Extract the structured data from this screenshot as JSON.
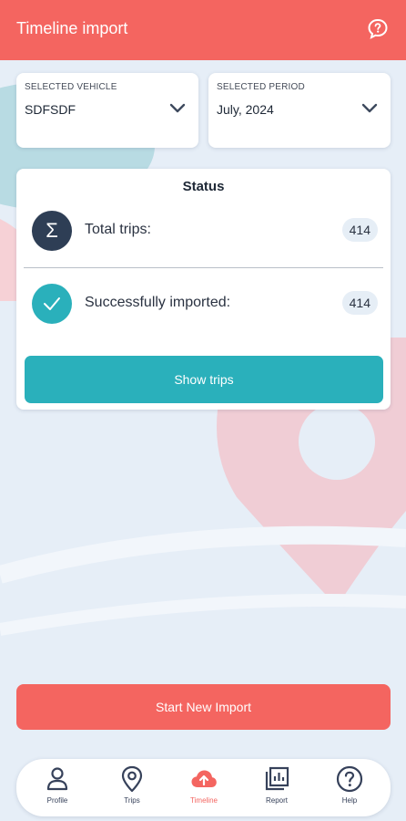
{
  "header": {
    "title": "Timeline import"
  },
  "selectors": {
    "vehicle": {
      "caption": "SELECTED VEHICLE",
      "value": "SDFSDF"
    },
    "period": {
      "caption": "SELECTED PERIOD",
      "value": "July, 2024"
    }
  },
  "status": {
    "title": "Status",
    "total": {
      "label": "Total trips:",
      "count": "414",
      "icon": "sigma-icon"
    },
    "imported": {
      "label": "Successfully imported:",
      "count": "414",
      "icon": "check-icon"
    },
    "show_trips_label": "Show trips"
  },
  "actions": {
    "start_import_label": "Start New Import"
  },
  "nav": {
    "items": [
      {
        "label": "Profile",
        "icon": "person-icon"
      },
      {
        "label": "Trips",
        "icon": "location-pin-icon"
      },
      {
        "label": "Timeline",
        "icon": "cloud-upload-icon",
        "active": true
      },
      {
        "label": "Report",
        "icon": "report-icon"
      },
      {
        "label": "Help",
        "icon": "help-icon"
      }
    ]
  },
  "colors": {
    "primary": "#f46560",
    "teal": "#2ab0bb",
    "navy": "#2e3e55",
    "background": "#e6eef7"
  }
}
